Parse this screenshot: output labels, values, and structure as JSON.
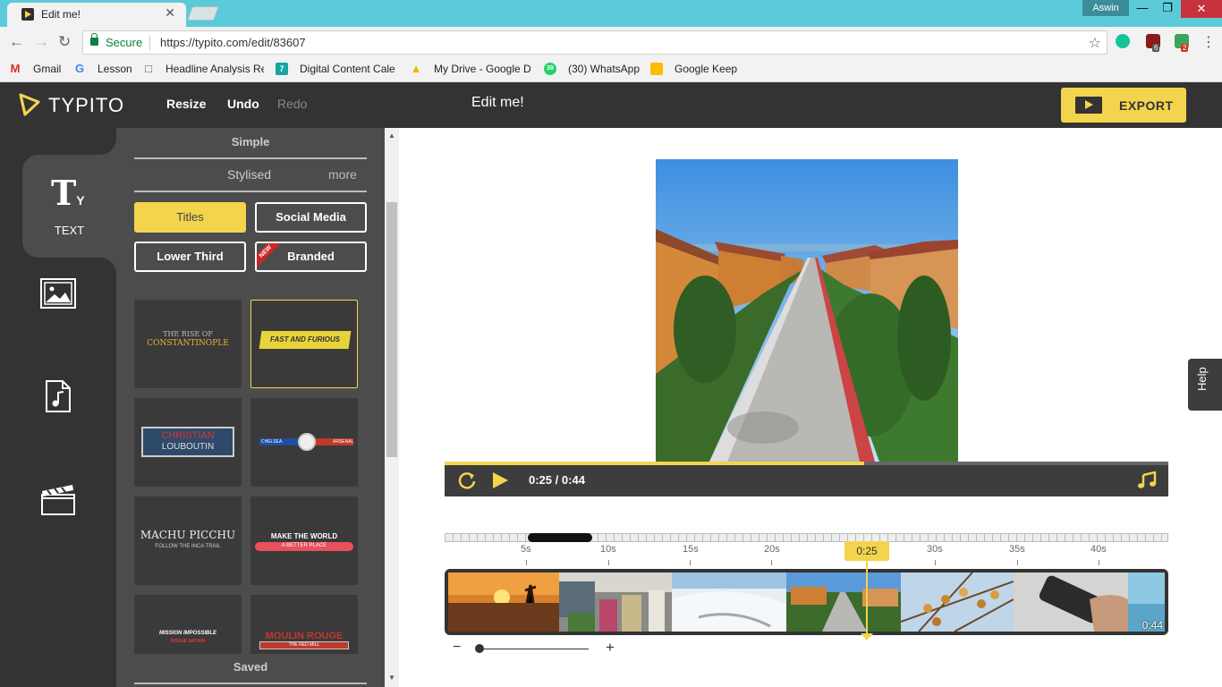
{
  "browser": {
    "tab_title": "Edit me!",
    "tab_close": "✕",
    "profile_name": "Aswin",
    "secure_label": "Secure",
    "url": "https://typito.com/edit/83607",
    "ext_badges": [
      "6",
      "2"
    ]
  },
  "bookmarks": [
    {
      "label": "Gmail",
      "icon": "gmail-icon",
      "color": "#d93025"
    },
    {
      "label": "Lesson",
      "icon": "google-icon",
      "color": "#4285f4"
    },
    {
      "label": "Headline Analysis Re",
      "icon": "doc-icon",
      "color": "#555"
    },
    {
      "label": "Digital Content Cale",
      "icon": "calendar-icon",
      "color": "#16a4a0"
    },
    {
      "label": "My Drive - Google D",
      "icon": "drive-icon",
      "color": "#f4b400"
    },
    {
      "label": "(30) WhatsApp",
      "icon": "whatsapp-icon",
      "color": "#25d366"
    },
    {
      "label": "Google Keep",
      "icon": "keep-icon",
      "color": "#fbbc04"
    }
  ],
  "app": {
    "logo": "TYPITO",
    "resize": "Resize",
    "undo": "Undo",
    "redo": "Redo",
    "doc_title": "Edit me!",
    "export": "EXPORT",
    "accent": "#f3d44d"
  },
  "rail": {
    "text_label": "TEXT",
    "text_glyph": "T",
    "text_glyph_sub": "Y"
  },
  "panel": {
    "tab_simple": "Simple",
    "tab_stylised": "Stylised",
    "tab_more": "more",
    "cats": {
      "titles": "Titles",
      "social": "Social Media",
      "lower_third": "Lower Third",
      "branded": "Branded",
      "new_badge": "NEW"
    },
    "templates": {
      "t1_line1": "THE RISE OF",
      "t1_line2": "CONSTANTINOPLE",
      "t2": "FAST AND FURIOUS",
      "t3_line1": "CHRISTIAN",
      "t3_line2": "LOUBOUTIN",
      "t4_left": "CHELSEA",
      "t4_right": "ARSENAL",
      "t5_line1": "MACHU PICCHU",
      "t5_line2": "FOLLOW THE INCA TRAIL",
      "t6_line1": "MAKE THE WORLD",
      "t6_line2": "A BETTER PLACE",
      "t7_line1": "MISSION IMPOSSIBLE",
      "t7_line2": "ROGUE NATION",
      "t8_line1": "MOULIN ROUGE",
      "t8_line2": "THE RED MILL"
    },
    "saved": "Saved"
  },
  "player": {
    "current": "0:25",
    "separator": "/",
    "total": "0:44",
    "progress": 0.58
  },
  "timeline": {
    "ticks": [
      "5s",
      "10s",
      "15s",
      "20s",
      "0:25",
      "30s",
      "35s",
      "40s"
    ],
    "playhead": "0:25",
    "duration": "0:44",
    "zoom_minus": "−",
    "zoom_plus": "+"
  },
  "help": "Help"
}
